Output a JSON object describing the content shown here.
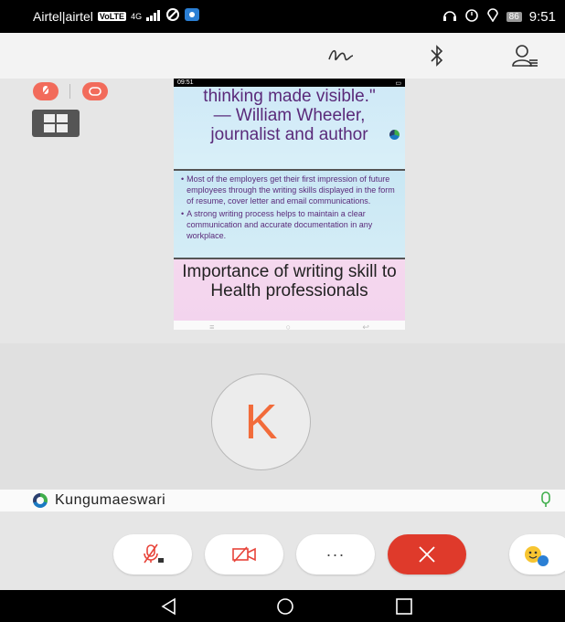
{
  "status_bar": {
    "carrier": "Airtel|airtel",
    "volte": "VoLTE",
    "network": "4G",
    "battery": "86",
    "time": "9:51"
  },
  "toolbar": {
    "icons": [
      "draw-icon",
      "bluetooth-icon",
      "participants-icon"
    ]
  },
  "share": {
    "phone_status_time": "09:51",
    "slide1_lines": [
      "thinking made visible.\"",
      "— William Wheeler,",
      "journalist and author"
    ],
    "bullets": [
      "Most of the employers get their first impression of future employees through the writing skills displayed in the form of resume, cover letter and email communications.",
      "A strong writing process helps to maintain a clear communication and accurate documentation in any workplace."
    ],
    "slide3_title": "Importance of writing skill to Health professionals"
  },
  "video": {
    "avatar_letter": "K"
  },
  "participant": {
    "name": "Kungumaeswari"
  },
  "controls": {
    "more_label": "···"
  },
  "colors": {
    "accent_orange": "#f26b3a",
    "end_call_red": "#df3a2b",
    "badge_red": "#f26b5b"
  }
}
